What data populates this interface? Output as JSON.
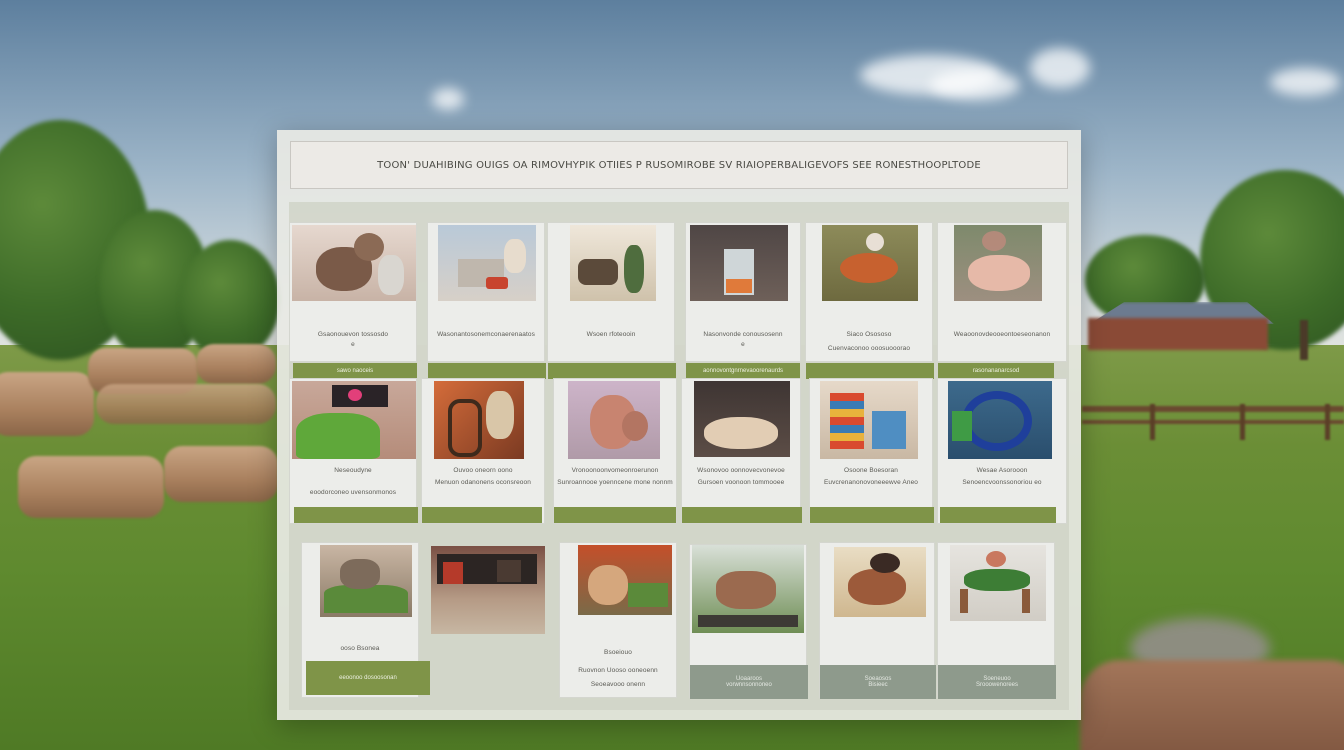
{
  "page": {
    "title": "TOON' DUAHIBING OUIGS OA RIMOVHYPIK OTIIES P RUSOMIROBE SV RIAIOPERBALIGEVOFS SEE RONESTHOOPLTODE"
  },
  "colors": {
    "accent_button": "#7f9448",
    "button_text": "#eef1e2",
    "panel": "#e8e9e4",
    "card": "#ecedea"
  },
  "cards": [
    {
      "thumb": "fluffy-animal",
      "caption": "Gsaonouevon tossosdo",
      "subcaption": "e",
      "button": "sawo naoceis"
    },
    {
      "thumb": "sink-display",
      "caption": "Wasonantosonemconaerenaatos",
      "subcaption": "",
      "button": ""
    },
    {
      "thumb": "armchair-vase",
      "caption": "Wsoen rfoteooin",
      "subcaption": "",
      "button": ""
    },
    {
      "thumb": "dispenser",
      "caption": "Nasonvonde conousosenn",
      "subcaption": "e",
      "button": "aonnovontgnrnevaoorenaurds"
    },
    {
      "thumb": "food-plate",
      "caption": "Siaco Osososo",
      "subcaption": "Cuenvaconoo ooosuooorao",
      "button": ""
    },
    {
      "thumb": "pig",
      "caption": "Weaoonovdeooeontoeseonanon",
      "subcaption": "",
      "button": "rasonananarcsod"
    },
    {
      "thumb": "salad-bowl",
      "caption": "Neseoudyne",
      "subcaption": "eoodorconeo uvensonmonos",
      "button": ""
    },
    {
      "thumb": "wooden-chair",
      "caption": "Ouvoo oneorn oono",
      "subcaption": "Menuon odanonens oconsreoon",
      "button": ""
    },
    {
      "thumb": "figurine",
      "caption": "Vronoonoonvomeonroerunon",
      "subcaption": "Sunroannooe yoenncene mone nonnm",
      "button": ""
    },
    {
      "thumb": "bread-loaf",
      "caption": "Wsonovoo oonnovecvonevoe",
      "subcaption": "Gursoen voonoon tommooee",
      "button": ""
    },
    {
      "thumb": "colorful-shelf",
      "caption": "Osoone Boesoran",
      "subcaption": "Euvcrenanonovoneeewve Aneo",
      "button": ""
    },
    {
      "thumb": "blue-sculpture",
      "caption": "Wesae Asorooon",
      "subcaption": "Senoencvoonssonoriou eo",
      "button": ""
    },
    {
      "thumb": "rocky-garden",
      "caption": "ooso Bsonea",
      "subcaption": "",
      "button": "eeoonoo dosoosonan"
    },
    {
      "thumb": "building-entrance",
      "caption": "",
      "subcaption": "",
      "button": ""
    },
    {
      "thumb": "bird-sculpture",
      "caption": "Bsoeiouo",
      "subcaption": "Ruovnon Uooso ooneoenn",
      "button": "Seoeavooo onenn"
    },
    {
      "thumb": "cow-statue",
      "caption": "Uoaaroos",
      "subcaption": "vorwnnsonnoneo",
      "button": ""
    },
    {
      "thumb": "roast-dish",
      "caption": "Soeaosos",
      "subcaption": "Bisieec",
      "button": ""
    },
    {
      "thumb": "green-animal",
      "caption": "Soeneuoo",
      "subcaption": "Srooowenorees",
      "button": ""
    }
  ]
}
